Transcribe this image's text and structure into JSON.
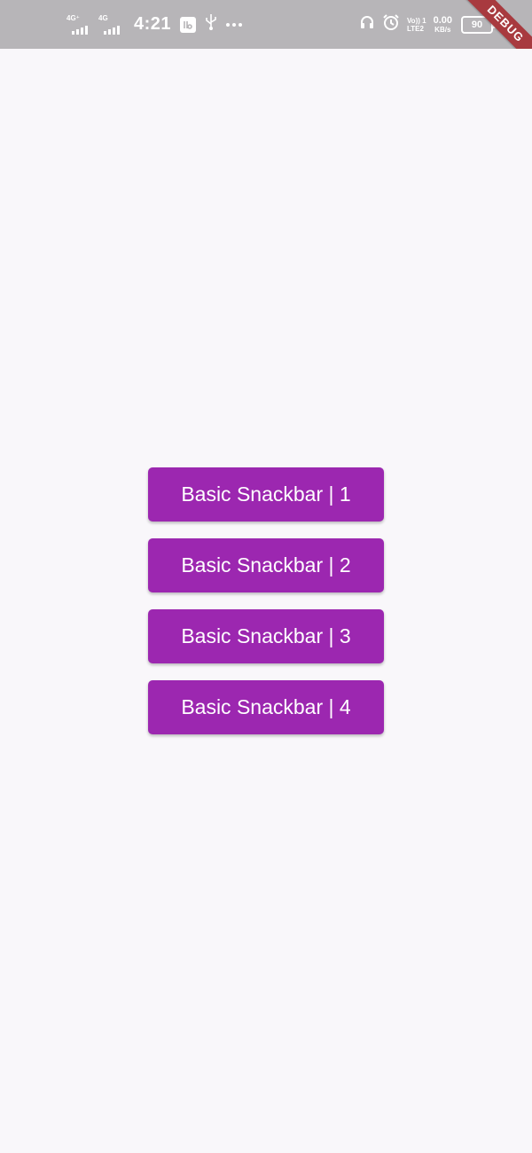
{
  "status_bar": {
    "network_1": "4G⁺",
    "network_2": "4G",
    "time": "4:21",
    "volte_top": "Vo)) 1",
    "volte_bottom": "LTE2",
    "speed_value": "0.00",
    "speed_unit": "KB/s",
    "battery_level": "90"
  },
  "debug_banner": "DEBUG",
  "buttons": [
    {
      "label": "Basic Snackbar | 1"
    },
    {
      "label": "Basic Snackbar | 2"
    },
    {
      "label": "Basic Snackbar | 3"
    },
    {
      "label": "Basic Snackbar | 4"
    }
  ],
  "colors": {
    "button_bg": "#9c27b0",
    "page_bg": "#f9f7fa",
    "status_bar_bg": "#b7b5b8",
    "debug_banner_bg": "#a83a3f"
  },
  "icons": [
    "signal-icon",
    "app-notification-icon",
    "usb-icon",
    "more-icon",
    "headphones-icon",
    "alarm-icon",
    "battery-icon",
    "charging-icon"
  ]
}
